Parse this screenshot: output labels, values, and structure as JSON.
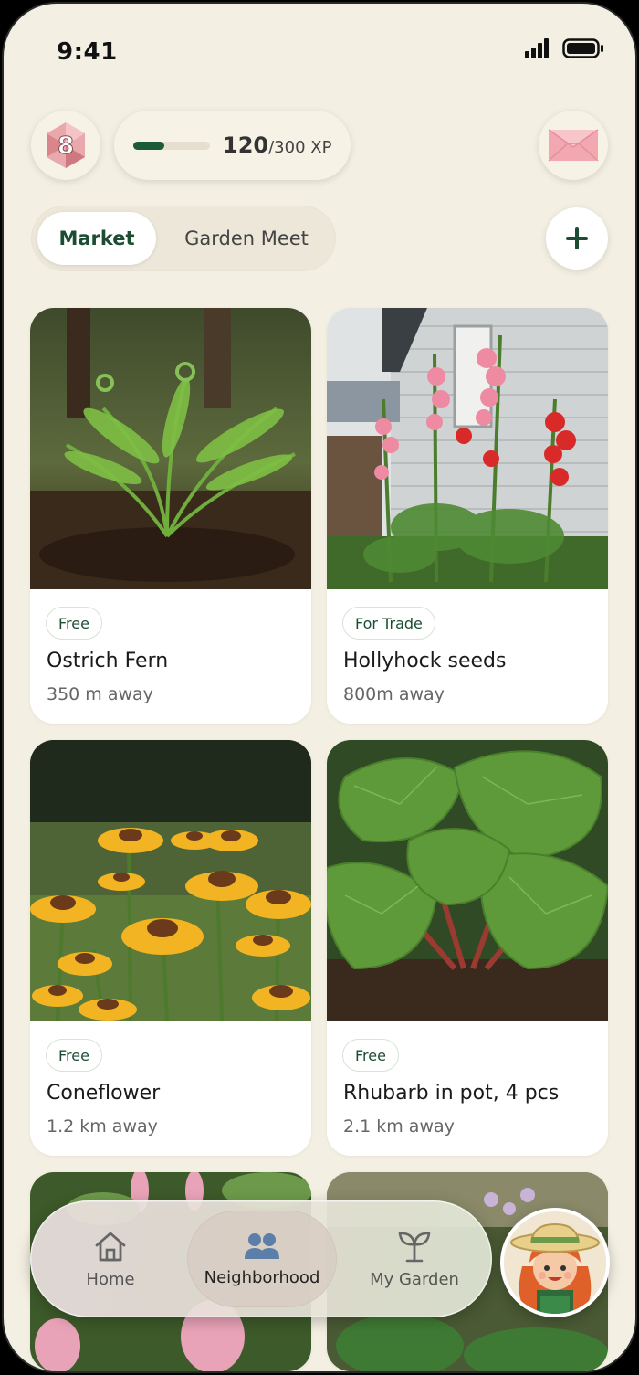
{
  "status_bar": {
    "time": "9:41"
  },
  "header": {
    "level": "8",
    "xp_current": "120",
    "xp_max": "/300 XP",
    "xp_progress": 0.4
  },
  "tabs": [
    {
      "label": "Market",
      "active": true
    },
    {
      "label": "Garden Meet",
      "active": false
    }
  ],
  "listings": [
    {
      "tag": "Free",
      "title": "Ostrich Fern",
      "distance": "350 m away"
    },
    {
      "tag": "For Trade",
      "title": "Hollyhock seeds",
      "distance": "800m away"
    },
    {
      "tag": "Free",
      "title": "Coneflower",
      "distance": "1.2 km away"
    },
    {
      "tag": "Free",
      "title": "Rhubarb in pot, 4 pcs",
      "distance": "2.1 km away"
    }
  ],
  "bottom_nav": {
    "items": [
      {
        "label": "Home",
        "icon": "home-icon",
        "active": false
      },
      {
        "label": "Neighborhood",
        "icon": "people-icon",
        "active": true
      },
      {
        "label": "My Garden",
        "icon": "sprout-icon",
        "active": false
      }
    ]
  },
  "colors": {
    "accent": "#1c5a3a",
    "background": "#f3efe2",
    "card": "#ffffff"
  }
}
